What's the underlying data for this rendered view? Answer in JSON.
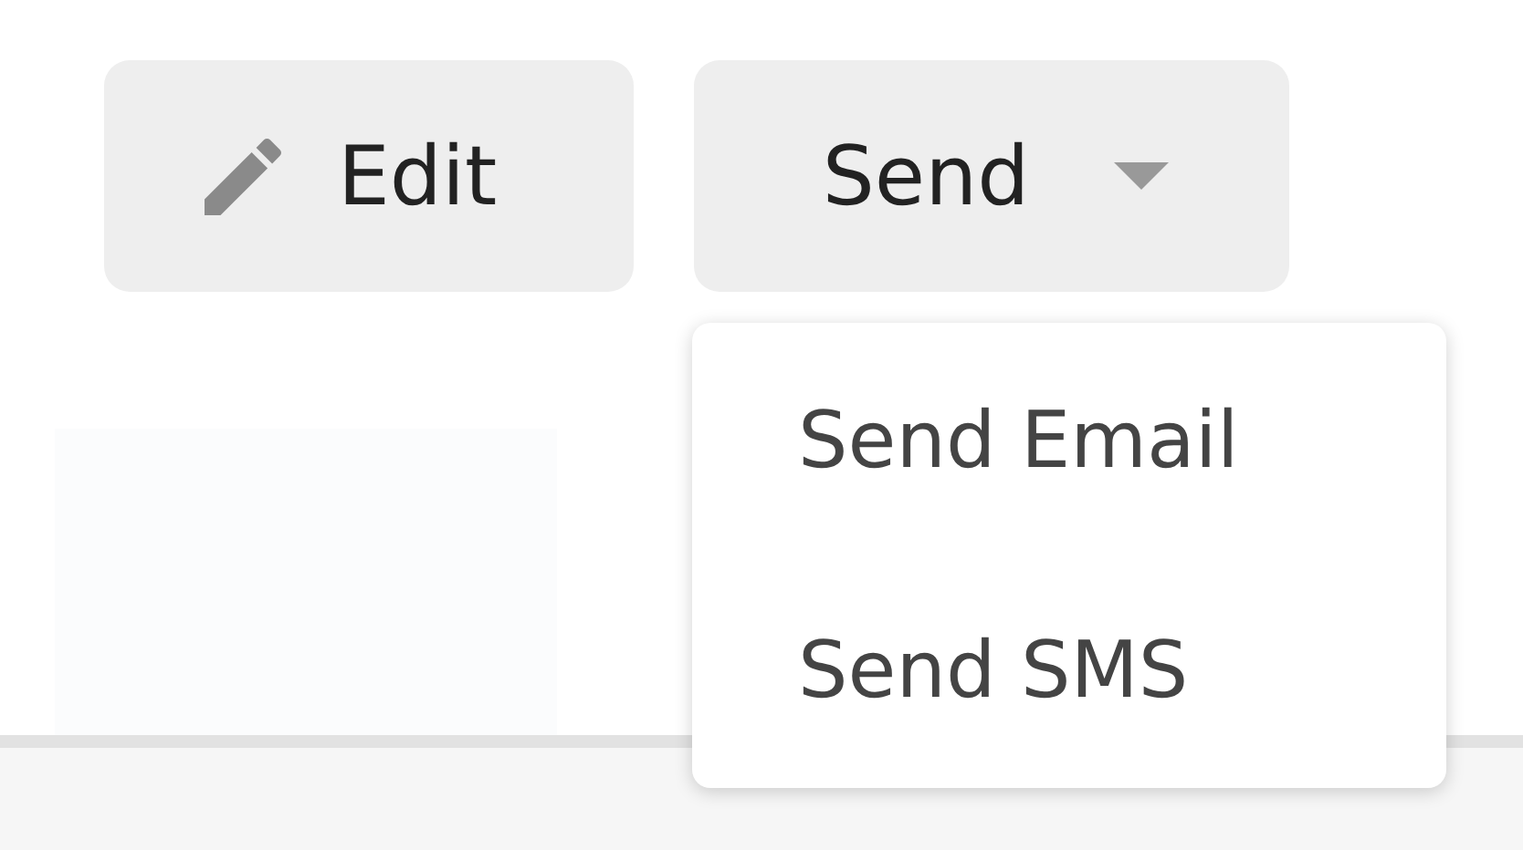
{
  "toolbar": {
    "buttons": [
      {
        "kind": "edit",
        "label": "Edit"
      },
      {
        "kind": "dropdown",
        "label": "Send"
      }
    ]
  },
  "menu": {
    "items": [
      {
        "label": "Send Email"
      },
      {
        "label": "Send SMS"
      }
    ]
  }
}
